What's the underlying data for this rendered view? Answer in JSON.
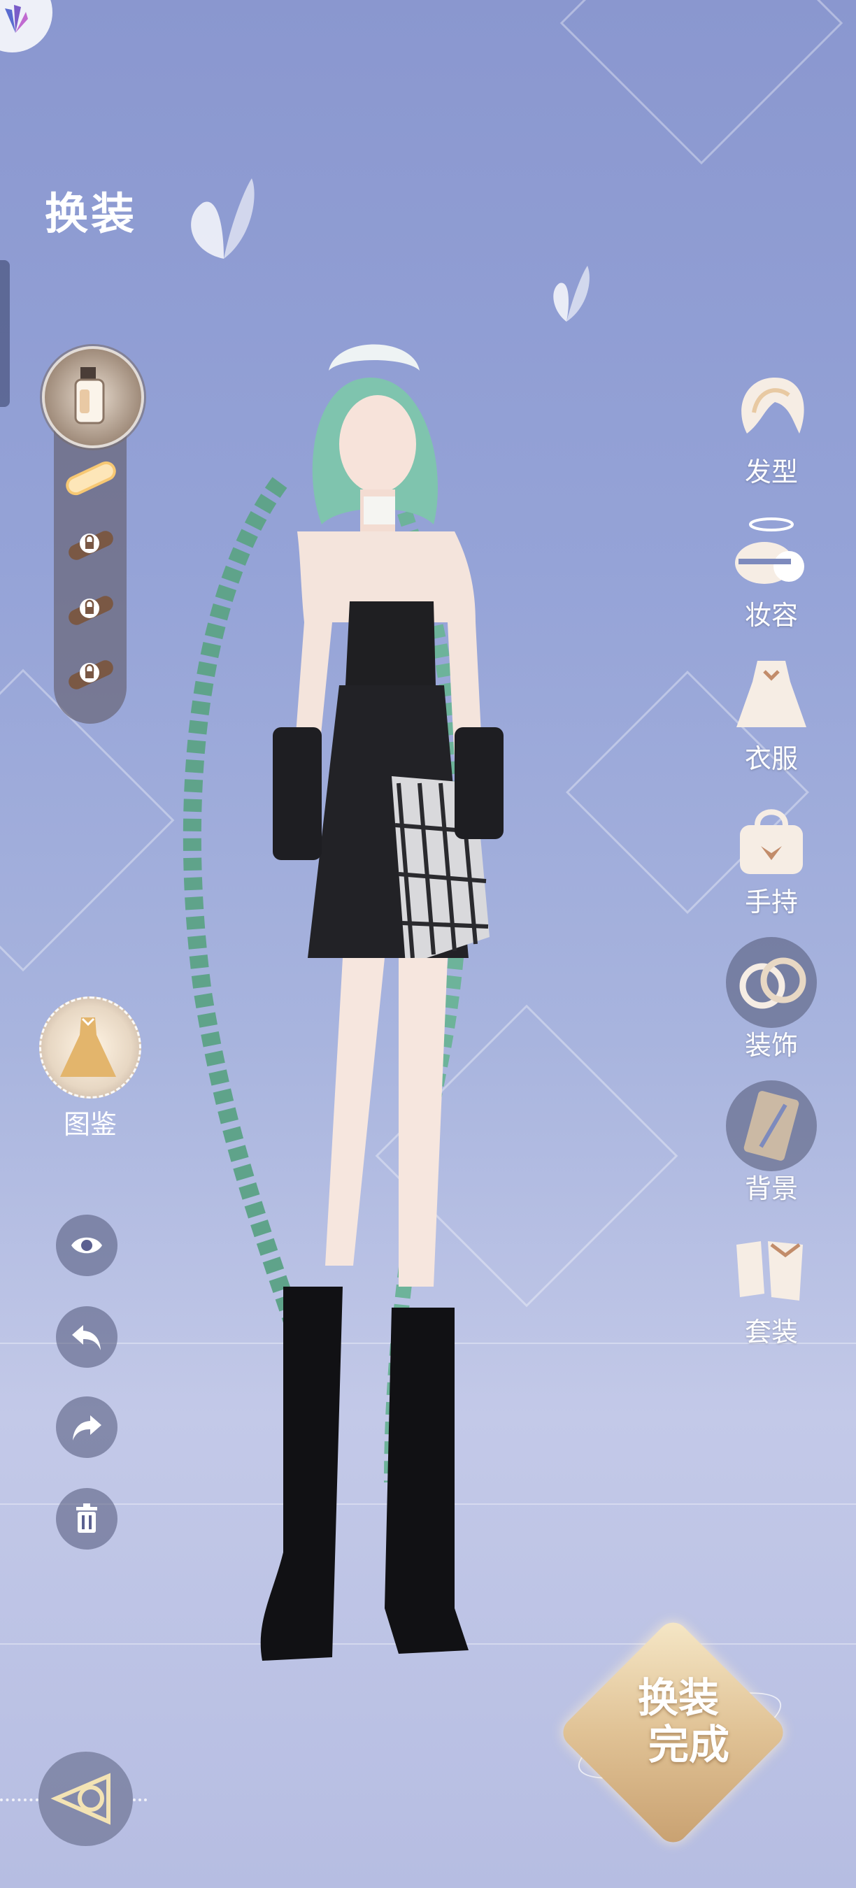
{
  "header": {
    "title": "换装"
  },
  "slots": {
    "top_icon": "lotion-bottle-icon"
  },
  "categories": [
    {
      "label": "发型",
      "icon": "hair-icon"
    },
    {
      "label": "妆容",
      "icon": "makeup-icon"
    },
    {
      "label": "衣服",
      "icon": "dress-icon"
    },
    {
      "label": "手持",
      "icon": "handbag-icon"
    },
    {
      "label": "装饰",
      "icon": "rings-icon"
    },
    {
      "label": "背景",
      "icon": "background-card-icon"
    },
    {
      "label": "套装",
      "icon": "outfit-set-icon"
    }
  ],
  "dex": {
    "label": "图鉴",
    "icon": "gown-icon"
  },
  "tools": [
    "eye-icon",
    "undo-icon",
    "redo-icon",
    "trash-icon"
  ],
  "done": {
    "line1": "换装",
    "line2": "完成"
  },
  "colors": {
    "accent_gold": "#e0c295",
    "bg_blue": "#95a3d7"
  }
}
